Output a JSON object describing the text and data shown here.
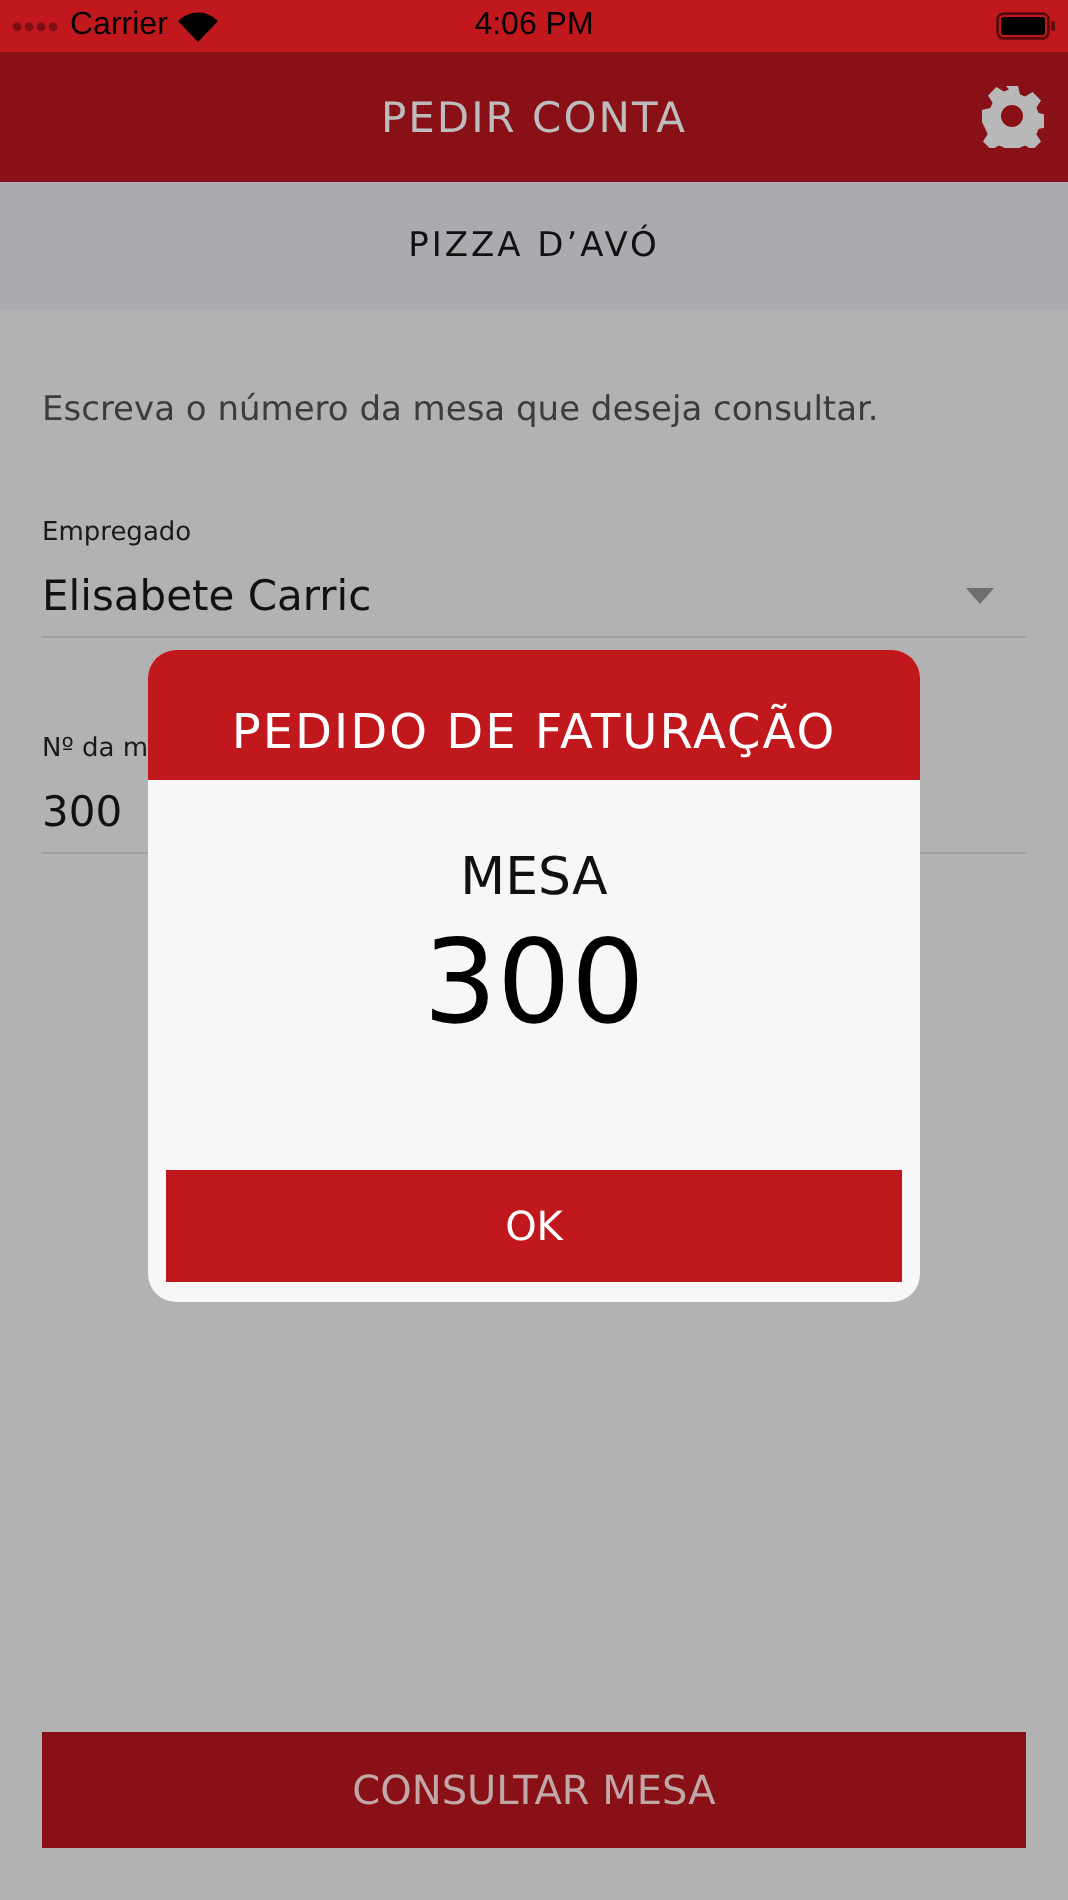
{
  "status_bar": {
    "carrier": "Carrier",
    "time": "4:06 PM"
  },
  "header": {
    "title": "PEDIR CONTA"
  },
  "subheader": {
    "title": "PIZZA D’AVÓ"
  },
  "instruction": "Escreva o número da mesa que deseja consultar.",
  "fields": [
    {
      "kind": "dropdown",
      "label": "Empregado",
      "value": "Elisabete Carric"
    },
    {
      "kind": "text",
      "label": "Nº da m",
      "value": "300"
    }
  ],
  "button": "CONSULTAR MESA",
  "dialog": {
    "title": "PEDIDO DE FATURAÇÃO",
    "label": "MESA",
    "number": "300",
    "button": "OK"
  }
}
